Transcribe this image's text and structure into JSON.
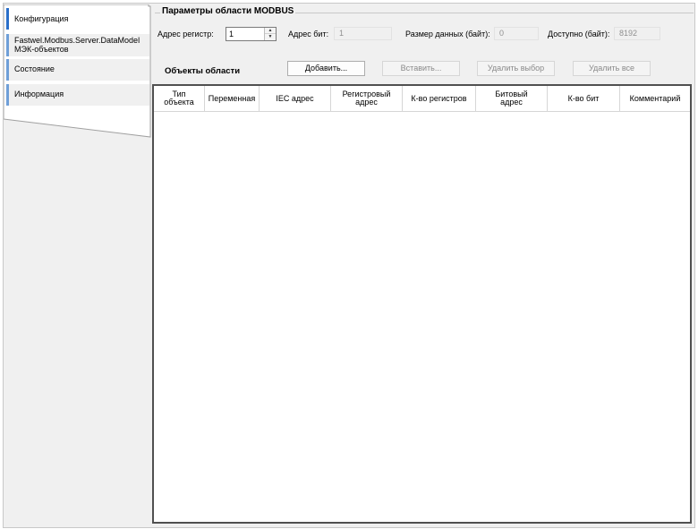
{
  "nav": {
    "items": [
      {
        "lines": [
          "Конфигурация"
        ]
      },
      {
        "lines": [
          "Fastwel.Modbus.Server.DataModel",
          "МЭК-объектов"
        ]
      },
      {
        "lines": [
          "Состояние"
        ]
      },
      {
        "lines": [
          "Информация"
        ]
      }
    ]
  },
  "params": {
    "title": "Параметры области MODBUS",
    "reg_addr_label": "Адрес регистр:",
    "reg_addr_value": "1",
    "bit_addr_label": "Адрес бит:",
    "bit_addr_value": "1",
    "data_size_label": "Размер данных (байт):",
    "data_size_value": "0",
    "available_label": "Доступно (байт):",
    "available_value": "8192"
  },
  "objects": {
    "title": "Объекты области",
    "buttons": {
      "add": "Добавить...",
      "paste": "Вставить...",
      "delete_selection": "Удалить выбор",
      "delete_all": "Удалить все"
    },
    "columns": [
      {
        "lines": [
          "Тип",
          "объекта"
        ]
      },
      {
        "lines": [
          "Переменная"
        ]
      },
      {
        "lines": [
          "IEC адрес"
        ]
      },
      {
        "lines": [
          "Регистровый",
          "адрес"
        ]
      },
      {
        "lines": [
          "К-во регистров"
        ]
      },
      {
        "lines": [
          "Битовый",
          "адрес"
        ]
      },
      {
        "lines": [
          "К-во бит"
        ]
      },
      {
        "lines": [
          "Комментарий"
        ]
      }
    ]
  },
  "colors": {
    "accent": "#2a6fc9",
    "panel": "#f0f0f0"
  }
}
